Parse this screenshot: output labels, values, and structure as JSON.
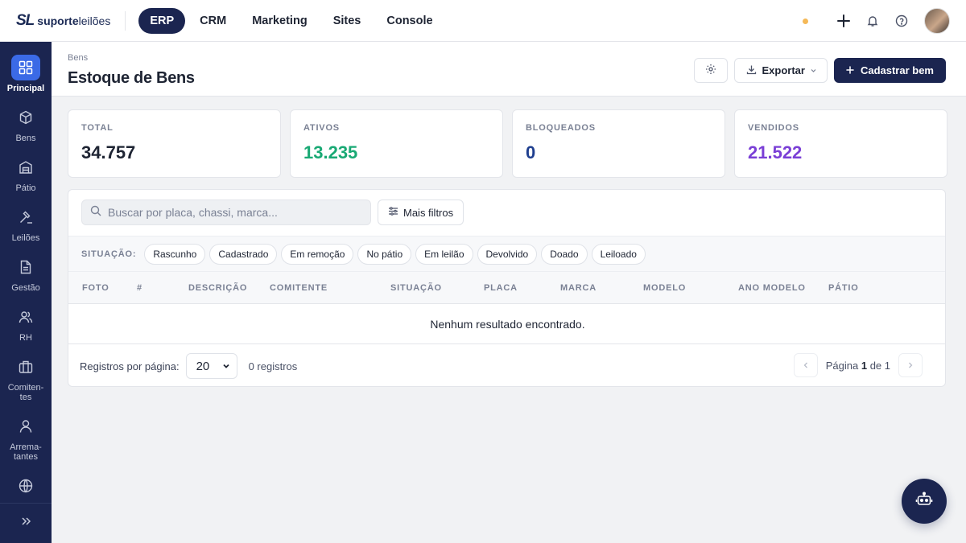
{
  "brand": {
    "mark": "SL",
    "bold": "suporte",
    "rest": "leilões"
  },
  "topnav": [
    {
      "label": "ERP",
      "active": true
    },
    {
      "label": "CRM",
      "active": false
    },
    {
      "label": "Marketing",
      "active": false
    },
    {
      "label": "Sites",
      "active": false
    },
    {
      "label": "Console",
      "active": false
    }
  ],
  "topbar_icons": [
    "status-dot",
    "plus-icon",
    "bell-icon",
    "help-icon",
    "avatar"
  ],
  "sidebar": {
    "items": [
      {
        "label": "Principal",
        "icon": "grid-icon",
        "active": true
      },
      {
        "label": "Bens",
        "icon": "box-icon"
      },
      {
        "label": "Pátio",
        "icon": "warehouse-icon"
      },
      {
        "label": "Leilões",
        "icon": "gavel-icon"
      },
      {
        "label": "Gestão",
        "icon": "document-icon"
      },
      {
        "label": "RH",
        "icon": "users-icon"
      },
      {
        "label": "Comiten-\ntes",
        "icon": "briefcase-icon"
      },
      {
        "label": "Arrema-\ntantes",
        "icon": "user-icon"
      },
      {
        "label": "",
        "icon": "globe-icon"
      }
    ],
    "toggle_icon": "chevrons-right-icon"
  },
  "header": {
    "breadcrumb": "Bens",
    "title": "Estoque de Bens",
    "export_label": "Exportar",
    "create_label": "Cadastrar bem"
  },
  "stats": [
    {
      "label": "TOTAL",
      "value": "34.757",
      "color": "#1e2433"
    },
    {
      "label": "ATIVOS",
      "value": "13.235",
      "color": "#19a974"
    },
    {
      "label": "BLOQUEADOS",
      "value": "0",
      "color": "#1f3f8f"
    },
    {
      "label": "VENDIDOS",
      "value": "21.522",
      "color": "#7a3fd6"
    }
  ],
  "filters": {
    "search_placeholder": "Buscar por placa, chassi, marca...",
    "more_filters_label": "Mais filtros",
    "status_label": "SITUAÇÃO:",
    "chips": [
      "Rascunho",
      "Cadastrado",
      "Em remoção",
      "No pátio",
      "Em leilão",
      "Devolvido",
      "Doado",
      "Leiloado"
    ]
  },
  "table": {
    "columns": [
      "FOTO",
      "#",
      "DESCRIÇÃO",
      "COMITENTE",
      "SITUAÇÃO",
      "PLACA",
      "MARCA",
      "MODELO",
      "ANO MODELO",
      "PÁTIO"
    ],
    "empty_message": "Nenhum resultado encontrado."
  },
  "pagination": {
    "per_page_label": "Registros por página:",
    "per_page_value": "20",
    "records": "0 registros",
    "page_prefix": "Página",
    "current_page": "1",
    "page_of": "de 1"
  },
  "colors": {
    "primary": "#1b2550",
    "accent": "#3b6ae6"
  }
}
